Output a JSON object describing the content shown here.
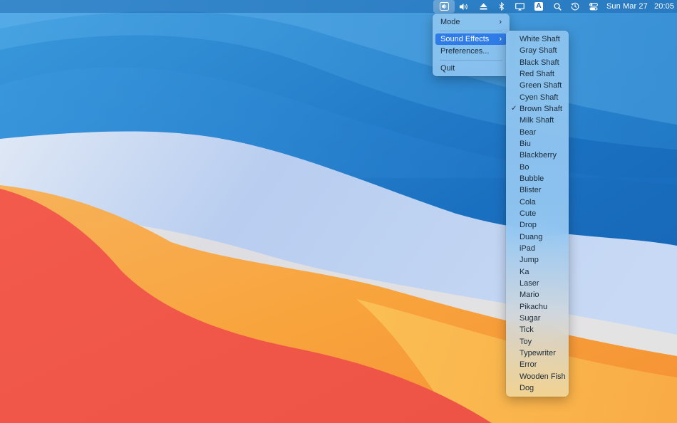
{
  "menubar": {
    "icons": [
      "sound-effects-app-icon",
      "volume-icon",
      "eject-icon",
      "bluetooth-icon",
      "display-icon",
      "input-source-icon",
      "spotlight-icon",
      "time-machine-icon",
      "control-center-icon"
    ],
    "input_source_letter": "A",
    "clock": {
      "date": "Sun Mar 27",
      "time": "20:05"
    }
  },
  "main_menu": {
    "items": [
      {
        "label": "Mode",
        "submenu": true
      },
      {
        "label": "Sound Effects",
        "submenu": true,
        "highlighted": true
      },
      {
        "label": "Preferences..."
      },
      {
        "label": "Quit"
      }
    ]
  },
  "sound_effects_menu": {
    "checked": "Brown Shaft",
    "items": [
      "White Shaft",
      "Gray Shaft",
      "Black Shaft",
      "Red Shaft",
      "Green Shaft",
      "Cyen Shaft",
      "Brown Shaft",
      "Milk Shaft",
      "Bear",
      "Biu",
      "Blackberry",
      "Bo",
      "Bubble",
      "Blister",
      "Cola",
      "Cute",
      "Drop",
      "Duang",
      "iPad",
      "Jump",
      "Ka",
      "Laser",
      "Mario",
      "Pikachu",
      "Sugar",
      "Tick",
      "Toy",
      "Typewriter",
      "Error",
      "Wooden Fish",
      "Dog"
    ]
  },
  "colors": {
    "highlight": "#2f7ce8",
    "wallpaper_blue": "#1c78c8",
    "wallpaper_red": "#f0514a",
    "wallpaper_orange": "#f8a13c"
  }
}
